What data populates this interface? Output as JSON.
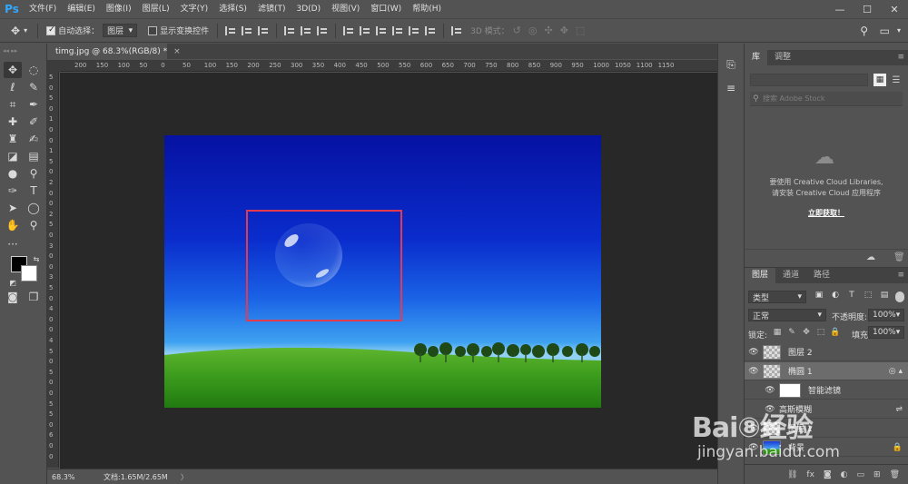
{
  "app": {
    "logo": "Ps"
  },
  "menu": [
    "文件(F)",
    "编辑(E)",
    "图像(I)",
    "图层(L)",
    "文字(Y)",
    "选择(S)",
    "滤镜(T)",
    "3D(D)",
    "视图(V)",
    "窗口(W)",
    "帮助(H)"
  ],
  "window_controls": {
    "minimize": "—",
    "restore": "☐",
    "close": "✕"
  },
  "options": {
    "auto_select_label": "自动选择：",
    "auto_select_target": "图层",
    "show_transform_label": "显示变换控件",
    "mode3d_label": "3D 模式："
  },
  "document": {
    "tab_title": "timg.jpg @ 68.3%(RGB/8) *",
    "close": "×"
  },
  "ruler": {
    "h_ticks": [
      "200",
      "150",
      "100",
      "50",
      "0",
      "50",
      "100",
      "150",
      "200",
      "250",
      "300",
      "350",
      "400",
      "450",
      "500",
      "550",
      "600",
      "650",
      "700",
      "750",
      "800",
      "850",
      "900",
      "950",
      "1000",
      "1050",
      "1100",
      "1150"
    ],
    "v_ticks": [
      "5",
      "0",
      "5",
      "0",
      "1",
      "0",
      "0",
      "1",
      "5",
      "0",
      "2",
      "0",
      "0",
      "2",
      "5",
      "0",
      "3",
      "0",
      "0",
      "3",
      "5",
      "0",
      "4",
      "0",
      "0",
      "4",
      "5",
      "0",
      "5",
      "0",
      "0",
      "5",
      "5",
      "0",
      "6",
      "0",
      "0"
    ]
  },
  "status": {
    "zoom": "68.3%",
    "doc_size": "文档:1.65M/2.65M",
    "arrow": "〉"
  },
  "panels": {
    "library": {
      "tabs": [
        "库",
        "调整"
      ],
      "search_placeholder": "搜索 Adobe Stock",
      "message_line1": "要使用 Creative Cloud Libraries,",
      "message_line2": "请安装 Creative Cloud 应用程序",
      "link": "立即获取！"
    },
    "layers": {
      "tabs": [
        "图层",
        "通道",
        "路径"
      ],
      "filter_kind": "类型",
      "blend_mode": "正常",
      "opacity_label": "不透明度:",
      "opacity": "100%",
      "lock_label": "锁定:",
      "fill_label": "填充:",
      "fill": "100%",
      "rows": [
        {
          "name": "图层 2"
        },
        {
          "name": "椭圆 1"
        },
        {
          "name": "智能滤镜"
        },
        {
          "name": "高斯模糊"
        },
        {
          "name": "图层 1"
        },
        {
          "name": "背景"
        }
      ]
    }
  },
  "watermark": {
    "logo": "Bai⑧经验",
    "url": "jingyan.baidu.com"
  }
}
